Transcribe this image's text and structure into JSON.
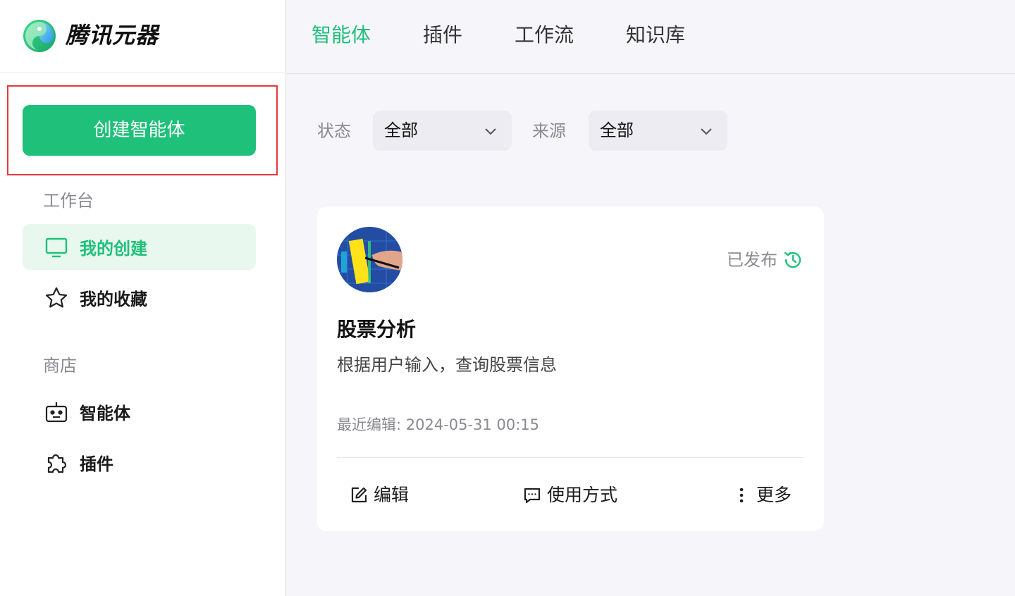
{
  "brand": {
    "name": "腾讯元器"
  },
  "sidebar": {
    "create_button": "创建智能体",
    "workbench_label": "工作台",
    "workbench_items": [
      {
        "label": "我的创建",
        "icon": "monitor-icon",
        "active": true
      },
      {
        "label": "我的收藏",
        "icon": "star-icon",
        "active": false
      }
    ],
    "store_label": "商店",
    "store_items": [
      {
        "label": "智能体",
        "icon": "robot-icon"
      },
      {
        "label": "插件",
        "icon": "puzzle-icon"
      }
    ]
  },
  "topnav": {
    "tabs": [
      {
        "label": "智能体",
        "active": true
      },
      {
        "label": "插件",
        "active": false
      },
      {
        "label": "工作流",
        "active": false
      },
      {
        "label": "知识库",
        "active": false
      }
    ]
  },
  "filters": {
    "status_label": "状态",
    "status_value": "全部",
    "source_label": "来源",
    "source_value": "全部"
  },
  "card": {
    "status": "已发布",
    "title": "股票分析",
    "description": "根据用户输入，查询股票信息",
    "last_edited": "最近编辑: 2024-05-31 00:15",
    "actions": {
      "edit": "编辑",
      "usage": "使用方式",
      "more": "更多"
    }
  },
  "colors": {
    "accent": "#1fc07a",
    "highlight_border": "#e5393d"
  }
}
